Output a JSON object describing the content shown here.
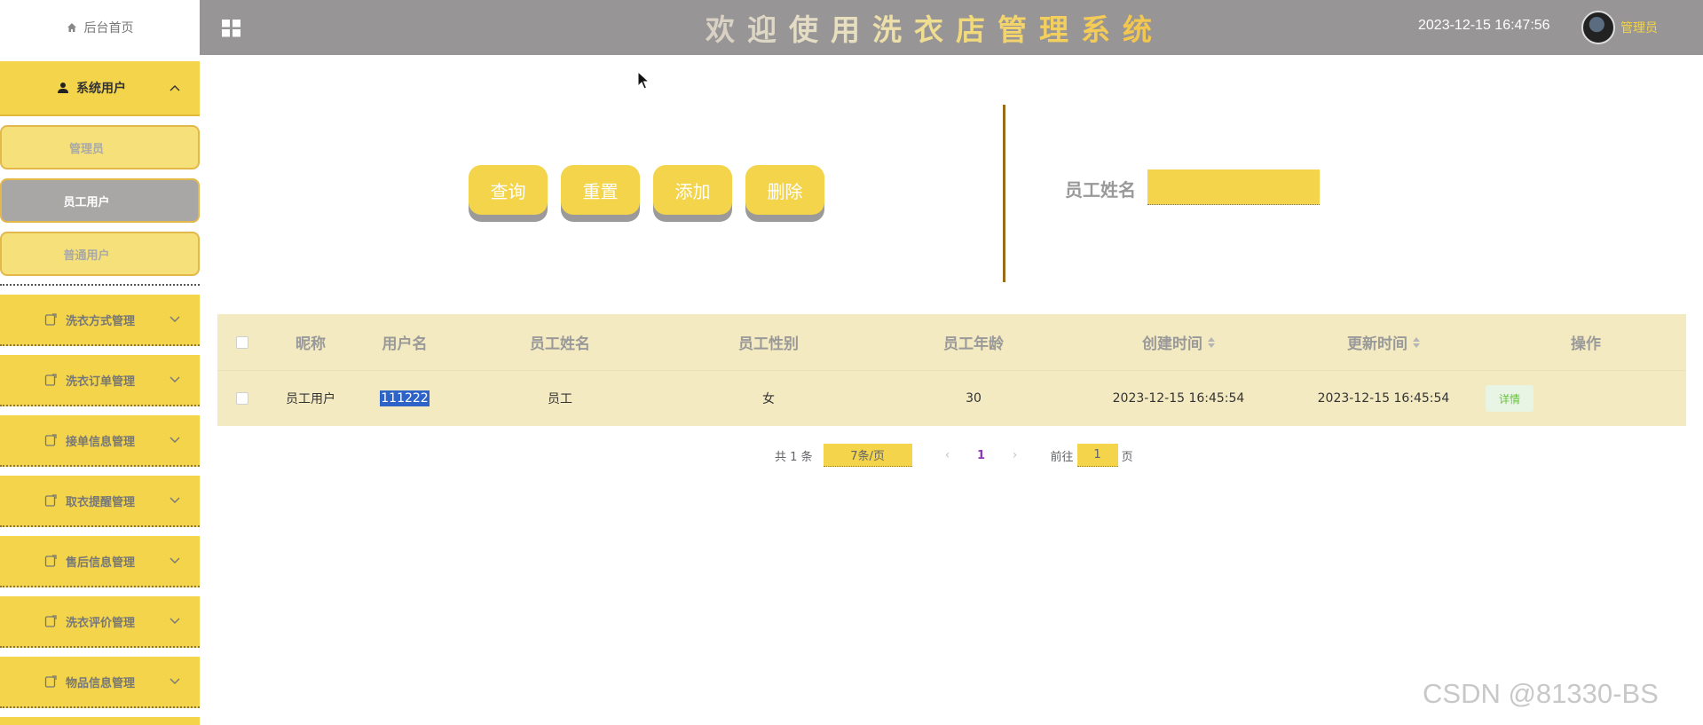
{
  "sidebar": {
    "home_label": "后台首页",
    "active_group": {
      "label": "系统用户",
      "icon": "user-icon"
    },
    "subitems": [
      {
        "label": "管理员",
        "active": false
      },
      {
        "label": "员工用户",
        "active": true
      },
      {
        "label": "普通用户",
        "active": false
      }
    ],
    "groups": [
      {
        "label": "洗衣方式管理"
      },
      {
        "label": "洗衣订单管理"
      },
      {
        "label": "接单信息管理"
      },
      {
        "label": "取衣提醒管理"
      },
      {
        "label": "售后信息管理"
      },
      {
        "label": "洗衣评价管理"
      },
      {
        "label": "物品信息管理"
      }
    ]
  },
  "header": {
    "title_chars": [
      "欢",
      "迎",
      "使",
      "用",
      "洗",
      "衣",
      "店",
      "管",
      "理",
      "系",
      "统"
    ],
    "title_colors": [
      "#d9d2c4",
      "#ded7c6",
      "#e4dcc4",
      "#e8dfbf",
      "#ecdfa9",
      "#efdd92",
      "#f2d97a",
      "#f3d46a",
      "#f3cf5e",
      "#f3cb56",
      "#f3c74f"
    ],
    "datetime": "2023-12-15 16:47:56",
    "user_name": "管理员"
  },
  "toolbar": {
    "query_label": "查询",
    "reset_label": "重置",
    "add_label": "添加",
    "delete_label": "删除"
  },
  "filter": {
    "label": "员工姓名",
    "value": ""
  },
  "table": {
    "columns": [
      "昵称",
      "用户名",
      "员工姓名",
      "员工性别",
      "员工年龄",
      "创建时间",
      "更新时间",
      "操作"
    ],
    "rows": [
      {
        "nickname": "员工用户",
        "username": "111222",
        "name": "员工",
        "gender": "女",
        "age": "30",
        "created": "2023-12-15 16:45:54",
        "updated": "2023-12-15 16:45:54",
        "action": "详情"
      }
    ]
  },
  "pagination": {
    "total_text": "共 1 条",
    "page_size": "7条/页",
    "current_page": "1",
    "goto_prefix": "前往",
    "goto_value": "1",
    "goto_suffix": "页"
  },
  "watermark": "CSDN @81330-BS",
  "colors": {
    "accent": "#f3d44b",
    "header_bg": "#979595",
    "table_bg": "#f4eac1"
  }
}
